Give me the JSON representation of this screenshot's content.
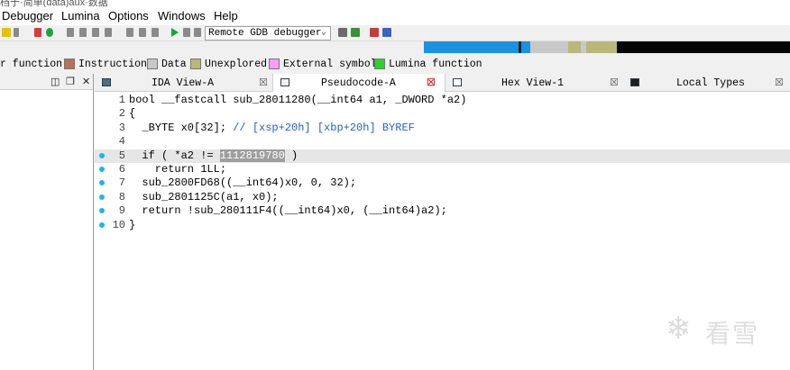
{
  "title_fragment": "档于·简单(data)aux·数据",
  "menu": [
    "Debugger",
    "Lumina",
    "Options",
    "Windows",
    "Help"
  ],
  "toolbar": {
    "debugger_select": "Remote GDB debugger"
  },
  "legend": [
    {
      "label": "r function",
      "color": ""
    },
    {
      "label": "Instruction",
      "color": "#b5715a"
    },
    {
      "label": "Data",
      "color": "#c8c8c8"
    },
    {
      "label": "Unexplored",
      "color": "#b8b87a"
    },
    {
      "label": "External symbol",
      "color": "#ff9cff"
    },
    {
      "label": "Lumina function",
      "color": "#2ed22e"
    }
  ],
  "tabs": [
    {
      "label": "IDA View-A",
      "active": false
    },
    {
      "label": "Pseudocode-A",
      "active": true
    },
    {
      "label": "Hex View-1",
      "active": false
    },
    {
      "label": "Local Types",
      "active": false
    }
  ],
  "code_lines": [
    {
      "num": "1",
      "text": "bool __fastcall sub_28011280(__int64 a1, _DWORD *a2)",
      "bp": false
    },
    {
      "num": "2",
      "text": "{",
      "bp": false
    },
    {
      "num": "3",
      "text": "  _BYTE x0[32]; ",
      "comment": "// [xsp+20h] [xbp+20h] BYREF",
      "bp": false
    },
    {
      "num": "4",
      "text": "",
      "bp": false
    },
    {
      "num": "5",
      "pre": "  if ( *a2 != ",
      "num_token": "1112819780",
      "post": " )",
      "bp": true,
      "current": true
    },
    {
      "num": "6",
      "text": "    return 1LL;",
      "bp": true
    },
    {
      "num": "7",
      "text": "  sub_2800FD68((__int64)x0, 0, 32);",
      "bp": true
    },
    {
      "num": "8",
      "text": "  sub_2801125C(a1, x0);",
      "bp": true
    },
    {
      "num": "9",
      "text": "  return !sub_280111F4((__int64)x0, (__int64)a2);",
      "bp": true
    },
    {
      "num": "10",
      "text": "}",
      "bp": true
    }
  ],
  "watermark": "看雪",
  "colors": {
    "accent_breakpoint": "#22b2e8",
    "comment": "#2b62b8",
    "current_line": "#e6e6e6"
  }
}
